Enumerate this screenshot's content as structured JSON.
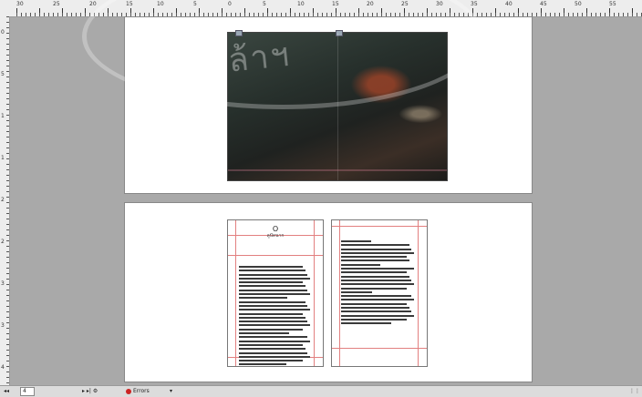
{
  "rulers": {
    "top_labels": [
      "30",
      "25",
      "20",
      "15",
      "10",
      "5",
      "0",
      "5",
      "10",
      "15",
      "20",
      "25",
      "30",
      "35",
      "40",
      "45",
      "50",
      "55"
    ],
    "left_labels": [
      "0",
      "5",
      "1",
      "1",
      "2",
      "2",
      "3",
      "3",
      "4"
    ]
  },
  "cover": {
    "description_image": "dark forest cover spread"
  },
  "text_spread": {
    "left_page_title": "O",
    "left_page_subtitle": "ลูปัดนาก",
    "left_line_count": 26,
    "right_line_count": 22
  },
  "statusbar": {
    "page_field": "4",
    "zoom_label": "1",
    "nav_controls": "▸ ▸| ⚙",
    "status_label": "Errors"
  },
  "watermark_text": "จอมเกล้าฯ"
}
